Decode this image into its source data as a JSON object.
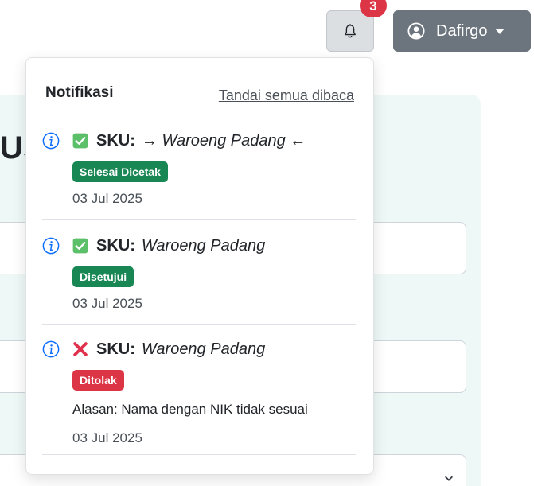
{
  "header": {
    "notification_count": "3",
    "user_name": "Dafirgo"
  },
  "notifications": {
    "title": "Notifikasi",
    "mark_all_read": "Tandai semua dibaca",
    "items": [
      {
        "status_icon": "check-box-icon",
        "sku_label": "SKU:",
        "sku_name": "→ Waroeng Padang ←",
        "status": "Selesai Dicetak",
        "status_color": "#198754",
        "reason": "",
        "date": "03 Jul 2025"
      },
      {
        "status_icon": "check-box-icon",
        "sku_label": "SKU:",
        "sku_name": "Waroeng Padang",
        "status": "Disetujui",
        "status_color": "#198754",
        "reason": "",
        "date": "03 Jul 2025"
      },
      {
        "status_icon": "cross-icon",
        "sku_label": "SKU:",
        "sku_name": "Waroeng Padang",
        "status": "Ditolak",
        "status_color": "#dc3545",
        "reason": "Alasan: Nama dengan NIK tidak sesuai",
        "date": "03 Jul 2025"
      }
    ]
  },
  "background": {
    "heading_fragment": "Us"
  },
  "colors": {
    "accent_green": "#198754",
    "accent_red": "#dc3545",
    "user_button": "#6c757d",
    "card_bg": "#eef8f7"
  }
}
